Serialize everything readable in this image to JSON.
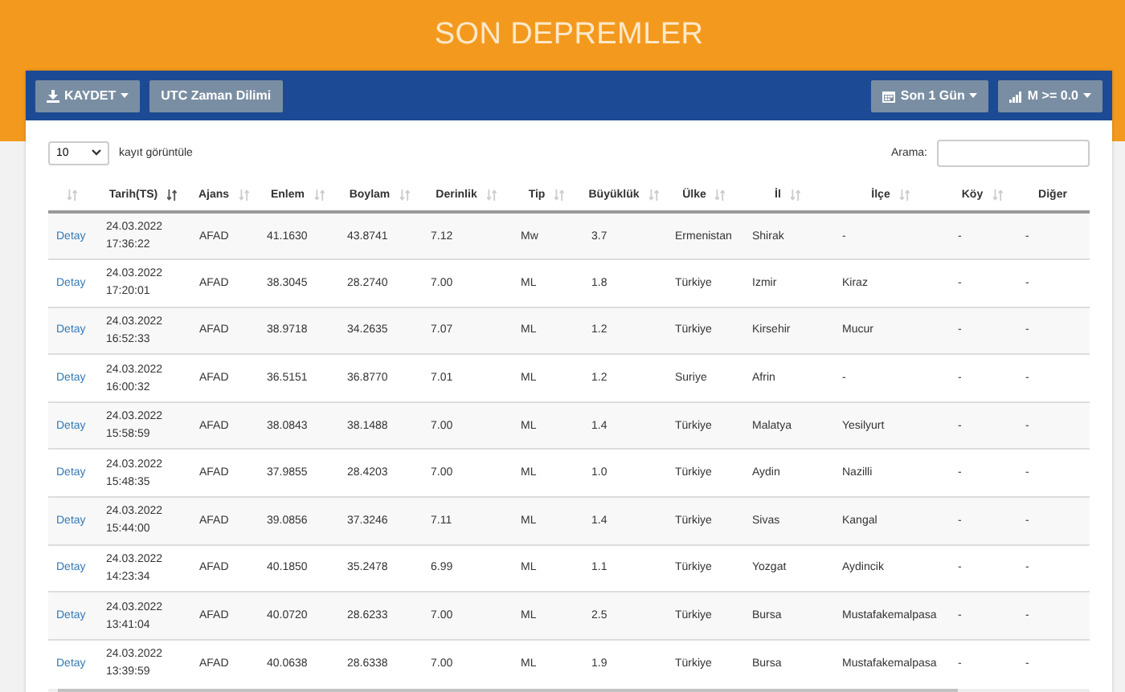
{
  "header": {
    "title": "SON DEPREMLER"
  },
  "toolbar": {
    "left_buttons": [
      {
        "label": "KAYDET",
        "dropdown": true
      },
      {
        "label": "UTC Zaman Dilimi",
        "dropdown": false
      }
    ],
    "right_buttons": [
      {
        "label": "Son 1 Gün",
        "dropdown": true
      },
      {
        "label": "M >= 0.0",
        "dropdown": true
      }
    ]
  },
  "controls": {
    "page_length": {
      "value": "10",
      "label": "kayıt görüntüle"
    },
    "search": {
      "label": "Arama:"
    }
  },
  "table": {
    "columns": [
      {
        "sortable": true,
        "sorted": false
      },
      {
        "label": "Tarih(TS)",
        "sortable": true,
        "sorted": true
      },
      {
        "label": "Ajans",
        "sortable": true,
        "sorted": false
      },
      {
        "label": "Enlem",
        "sortable": true,
        "sorted": false
      },
      {
        "label": "Boylam",
        "sortable": true,
        "sorted": false
      },
      {
        "label": "Derinlik",
        "sortable": true,
        "sorted": false
      },
      {
        "label": "Tip",
        "sortable": true,
        "sorted": false
      },
      {
        "label": "Büyüklük",
        "sortable": true,
        "sorted": false
      },
      {
        "label": "Ülke",
        "sortable": true,
        "sorted": false
      },
      {
        "label": "İl",
        "sortable": true,
        "sorted": false
      },
      {
        "label": "İlçe",
        "sortable": true,
        "sorted": false
      },
      {
        "label": "Köy",
        "sortable": true,
        "sorted": false
      },
      {
        "label": "Diğer",
        "sortable": false
      }
    ],
    "rows": [
      [
        "Detay",
        "24.03.2022 17:36:22",
        "AFAD",
        "41.1630",
        "43.8741",
        "7.12",
        "Mw",
        "3.7",
        "Ermenistan",
        "Shirak",
        "-",
        "-",
        "-"
      ],
      [
        "Detay",
        "24.03.2022 17:20:01",
        "AFAD",
        "38.3045",
        "28.2740",
        "7.00",
        "ML",
        "1.8",
        "Türkiye",
        "Izmir",
        "Kiraz",
        "-",
        "-"
      ],
      [
        "Detay",
        "24.03.2022 16:52:33",
        "AFAD",
        "38.9718",
        "34.2635",
        "7.07",
        "ML",
        "1.2",
        "Türkiye",
        "Kirsehir",
        "Mucur",
        "-",
        "-"
      ],
      [
        "Detay",
        "24.03.2022 16:00:32",
        "AFAD",
        "36.5151",
        "36.8770",
        "7.01",
        "ML",
        "1.2",
        "Suriye",
        "Afrin",
        "-",
        "-",
        "-"
      ],
      [
        "Detay",
        "24.03.2022 15:58:59",
        "AFAD",
        "38.0843",
        "38.1488",
        "7.00",
        "ML",
        "1.4",
        "Türkiye",
        "Malatya",
        "Yesilyurt",
        "-",
        "-"
      ],
      [
        "Detay",
        "24.03.2022 15:48:35",
        "AFAD",
        "37.9855",
        "28.4203",
        "7.00",
        "ML",
        "1.0",
        "Türkiye",
        "Aydin",
        "Nazilli",
        "-",
        "-"
      ],
      [
        "Detay",
        "24.03.2022 15:44:00",
        "AFAD",
        "39.0856",
        "37.3246",
        "7.11",
        "ML",
        "1.4",
        "Türkiye",
        "Sivas",
        "Kangal",
        "-",
        "-"
      ],
      [
        "Detay",
        "24.03.2022 14:23:34",
        "AFAD",
        "40.1850",
        "35.2478",
        "6.99",
        "ML",
        "1.1",
        "Türkiye",
        "Yozgat",
        "Aydincik",
        "-",
        "-"
      ],
      [
        "Detay",
        "24.03.2022 13:41:04",
        "AFAD",
        "40.0720",
        "28.6233",
        "7.00",
        "ML",
        "2.5",
        "Türkiye",
        "Bursa",
        "Mustafakemalpasa",
        "-",
        "-"
      ],
      [
        "Detay",
        "24.03.2022 13:39:59",
        "AFAD",
        "40.0638",
        "28.6338",
        "7.00",
        "ML",
        "1.9",
        "Türkiye",
        "Bursa",
        "Mustafakemalpasa",
        "-",
        "-"
      ]
    ]
  }
}
